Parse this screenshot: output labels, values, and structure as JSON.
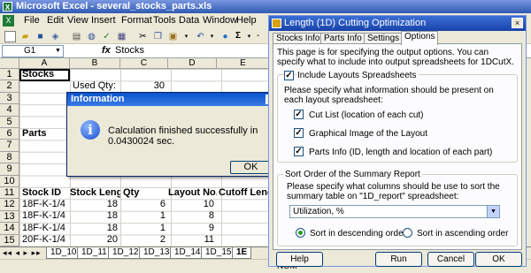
{
  "excel": {
    "title": "Microsoft Excel - several_stocks_parts.xls",
    "menu": [
      "File",
      "Edit",
      "View",
      "Insert",
      "Format",
      "Tools",
      "Data",
      "Window",
      "Help"
    ],
    "toolbar_sigma": "Σ",
    "zoom_tail": "-",
    "name_box": "G1",
    "fx": "fx",
    "formula_value": "Stocks",
    "columns": [
      "A",
      "B",
      "C",
      "D",
      "E"
    ],
    "rows": [
      "1",
      "2",
      "3",
      "4",
      "5",
      "6",
      "7",
      "8",
      "9",
      "10",
      "11",
      "12",
      "13",
      "14",
      "15",
      "16"
    ],
    "cells": {
      "a1": "Stocks",
      "b2": "Used Qty:",
      "c2": "30",
      "a6": "Parts",
      "a11": "Stock ID",
      "b11": "Stock Length",
      "c11": "Qty",
      "d11": "Layout No.",
      "e11": "Cutoff Length",
      "data_rows": [
        {
          "a": "18F-K-1/4",
          "b": "18",
          "c": "6",
          "d": "10"
        },
        {
          "a": "18F-K-1/4",
          "b": "18",
          "c": "1",
          "d": "8"
        },
        {
          "a": "18F-K-1/4",
          "b": "18",
          "c": "1",
          "d": "9"
        },
        {
          "a": "20F-K-1/4",
          "b": "20",
          "c": "2",
          "d": "11"
        },
        {
          "a": "20F-K-1/4",
          "b": "20",
          "c": "1",
          "d": "14"
        }
      ]
    },
    "sheet_nav": "◂◂ ◂ ▸ ▸▸",
    "sheet_tabs": [
      "1D_10",
      "1D_11",
      "1D_12",
      "1D_13",
      "1D_14",
      "1D_15",
      "1E"
    ],
    "status": "NUM"
  },
  "info_dialog": {
    "title": "Information",
    "close": "×",
    "icon": "i",
    "message": "Calculation finished successfully in 0.0430024 sec.",
    "ok": "OK"
  },
  "cut_dialog": {
    "title": "Length (1D) Cutting Optimization",
    "close": "×",
    "tabs": [
      "Stocks Info",
      "Parts Info",
      "Settings",
      "Options"
    ],
    "intro": "This page is for specifying the output options. You can specify what to include into output spreadsheets for 1DCutX.",
    "include_label": "Include Layouts Spreadsheets",
    "include_desc": "Please specify what information should be present on each layout spreadsheet:",
    "options": [
      "Cut List (location of each cut)",
      "Graphical Image of the Layout",
      "Parts Info (ID, length and location of each part)"
    ],
    "sort_title": "Sort Order of the Summary Report",
    "sort_desc": "Please specify what columns should be use to sort the summary table on \"1D_report\" spreadsheet:",
    "sort_value": "Utilization, %",
    "radio_desc": "Sort in descending order",
    "radio_asc": "Sort in ascending order",
    "buttons": {
      "help": "Help",
      "run": "Run",
      "cancel": "Cancel",
      "ok": "OK"
    }
  }
}
